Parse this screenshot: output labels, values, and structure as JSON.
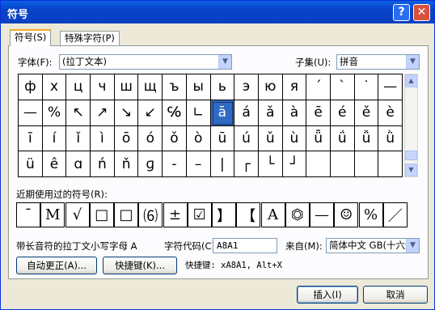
{
  "window": {
    "title": "符号",
    "help_label": "?",
    "close_label": "✕"
  },
  "tabs": [
    {
      "label": "符号(S)"
    },
    {
      "label": "特殊字符(P)"
    }
  ],
  "font": {
    "label": "字体(F):",
    "value": "(拉丁文本)"
  },
  "subset": {
    "label": "子集(U):",
    "value": "拼音"
  },
  "symbols": [
    "ф",
    "х",
    "ц",
    "ч",
    "ш",
    "щ",
    "ъ",
    "ы",
    "ь",
    "э",
    "ю",
    "я",
    "ˊ",
    "ˋ",
    "˙",
    "—",
    "—",
    "%",
    "↖",
    "↗",
    "↘",
    "↙",
    "℅",
    "∟",
    "ā",
    "á",
    "ǎ",
    "à",
    "ē",
    "é",
    "ě",
    "è",
    "ī",
    "í",
    "ǐ",
    "ì",
    "ō",
    "ó",
    "ǒ",
    "ò",
    "ū",
    "ú",
    "ǔ",
    "ù",
    "ǖ",
    "ǘ",
    "ǚ",
    "ǜ",
    "ü",
    "ê",
    "ɑ",
    "ń",
    "ň",
    "ɡ",
    "-",
    "–",
    "|",
    "┌",
    "└",
    "┘",
    "",
    "",
    "",
    ""
  ],
  "selected_index": 24,
  "recent": {
    "label": "近期使用过的符号(R):",
    "items": [
      "¯",
      "M",
      "√",
      "□",
      "□",
      "⑹",
      "±",
      "☑",
      "】",
      "【",
      "A",
      "⏣",
      "—",
      "☺",
      "%",
      "／"
    ]
  },
  "char_name": "带长音符的拉丁文小写字母 A",
  "char_code": {
    "label": "字符代码(C):",
    "value": "A8A1"
  },
  "from": {
    "label": "来自(M):",
    "value": "简体中文 GB(十六进制)"
  },
  "buttons": {
    "autocorrect": "自动更正(A)...",
    "shortcut": "快捷键(K)...",
    "insert": "插入(I)",
    "cancel": "取消"
  },
  "shortcut_text": "快捷键: xA8A1, Alt+X"
}
